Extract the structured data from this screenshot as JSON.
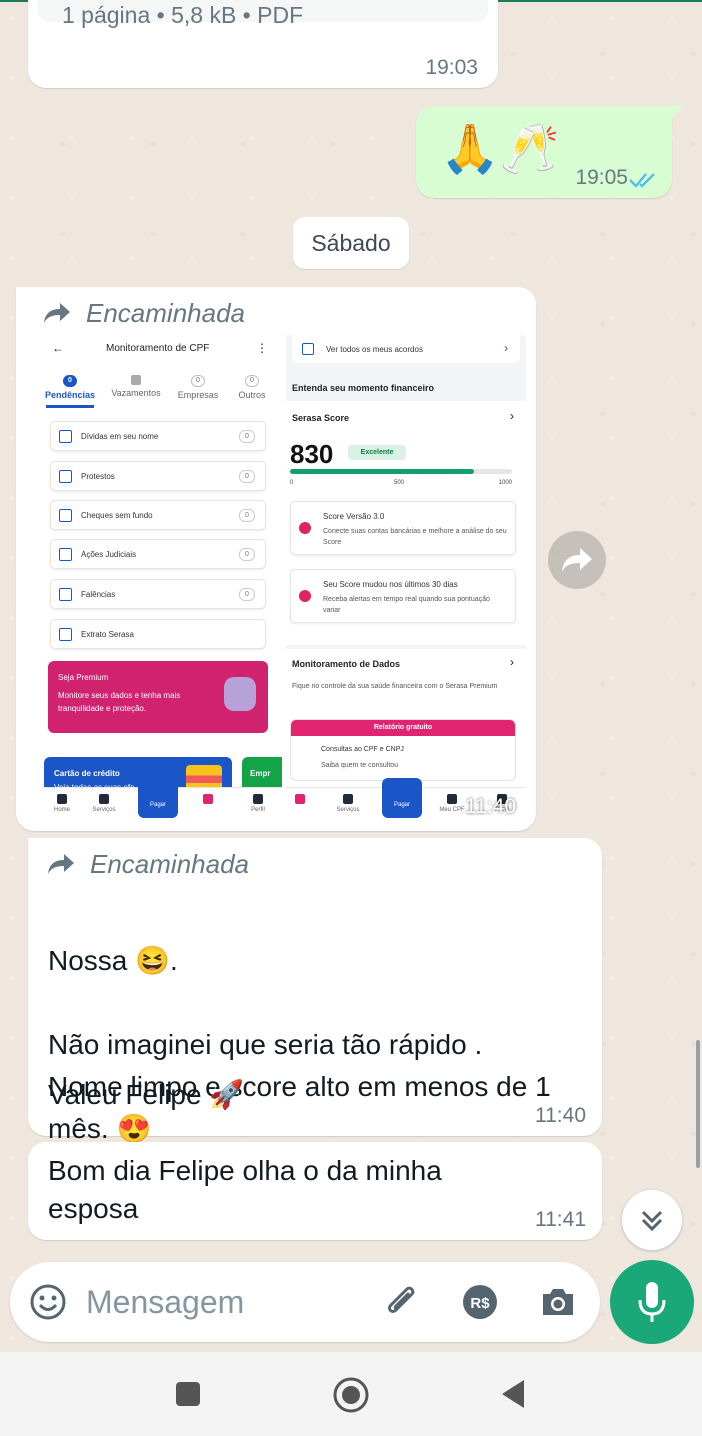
{
  "pdf_message": {
    "meta": "1 página • 5,8 kB • PDF",
    "time": "19:03"
  },
  "sent_message": {
    "emojis": "🙏🥂",
    "time": "19:05"
  },
  "date_chip": "Sábado",
  "forwarded_image": {
    "forward_label": "Encaminhada",
    "time": "11:40",
    "screenshot_left": {
      "title": "Monitoramento de CPF",
      "tabs": [
        {
          "label": "Pendências",
          "count": "0"
        },
        {
          "label": "Vazamentos",
          "count": ""
        },
        {
          "label": "Empresas",
          "count": "0"
        },
        {
          "label": "Outros",
          "count": "0"
        }
      ],
      "items": [
        {
          "label": "Dívidas em seu nome",
          "count": "0"
        },
        {
          "label": "Protestos",
          "count": "0"
        },
        {
          "label": "Cheques sem fundo",
          "count": "0"
        },
        {
          "label": "Ações Judiciais",
          "count": "0"
        },
        {
          "label": "Falências",
          "count": "0"
        },
        {
          "label": "Extrato Serasa",
          "count": ""
        }
      ],
      "premium_title": "Seja Premium",
      "premium_text": "Monitore seus dados e tenha mais tranquilidade e proteção.",
      "credit_card": "Cartão de crédito",
      "credit_sub": "Veja todas as suas ofe",
      "green_card": "Empr",
      "nav": [
        "Home",
        "Serviços",
        "Pagar",
        "",
        "Perfil"
      ]
    },
    "screenshot_right": {
      "acordos": "Ver todos os meus acordos",
      "section1": "Entenda seu momento financeiro",
      "score_title": "Serasa Score",
      "score": "830",
      "score_badge": "Excelente",
      "score_fraction": 0.83,
      "ticks": [
        "0",
        "500",
        "1000"
      ],
      "card1_title": "Score Versão 3.0",
      "card1_body": "Conecte suas contas bancárias e melhore a análise do seu Score",
      "card2_title": "Seu Score mudou nos últimos 30 dias",
      "card2_body": "Receba alertas em tempo real quando sua pontuação variar",
      "section2": "Monitoramento de Dados",
      "section2_body": "Fique no controle da sua saúde financeira com o Serasa Premium",
      "relatorio": "Relatório gratuito",
      "consultas_title": "Consultas ao CPF e CNPJ",
      "consultas_body": "Saiba quem te consultou",
      "nav": [
        "",
        "Serviços",
        "Pagar",
        "Meu CPF",
        "Perfil"
      ]
    }
  },
  "text_message": {
    "forward_label": "Encaminhada",
    "line1": "Nossa 😆.",
    "body": "Não imaginei que seria tão rápido .\nNome limpo e score alto em menos de 1 mês. 😍",
    "line_last": "Valeu Felipe 🚀",
    "time": "11:40"
  },
  "text_message2": {
    "body": "Bom dia Felipe olha o da minha esposa",
    "time": "11:41"
  },
  "composer": {
    "placeholder": "Mensagem"
  },
  "icons": {
    "emoji": "emoji-icon",
    "attach": "paperclip-icon",
    "payment": "rs-payment-icon",
    "camera": "camera-icon",
    "mic": "mic-icon"
  },
  "colors": {
    "accent": "#1aa878",
    "sent_bubble": "#d9fdd3",
    "chat_bg": "#efe7de",
    "ticks": "#53bdeb"
  }
}
